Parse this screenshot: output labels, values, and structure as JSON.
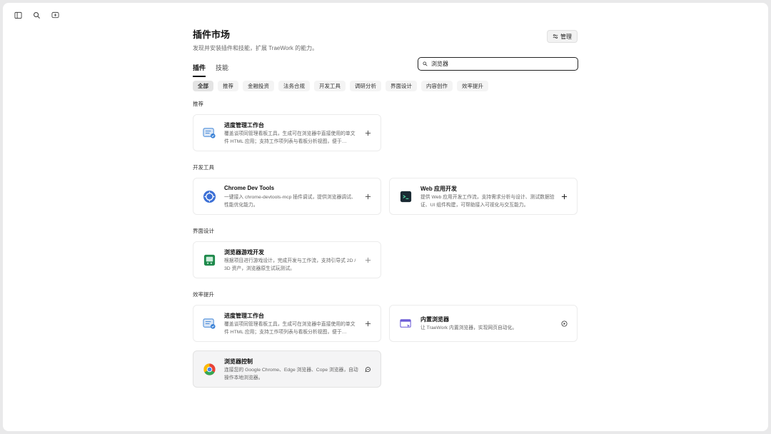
{
  "page": {
    "title": "插件市场",
    "subtitle": "发现并安装插件和技能，扩展 TraeWork 的能力。",
    "manage_label": "管理"
  },
  "tabs": [
    {
      "label": "插件",
      "active": true
    },
    {
      "label": "技能",
      "active": false
    }
  ],
  "search": {
    "value": "浏览器",
    "placeholder": "搜索"
  },
  "categories": [
    {
      "label": "全部",
      "active": true
    },
    {
      "label": "推荐"
    },
    {
      "label": "金融投资"
    },
    {
      "label": "法务合规"
    },
    {
      "label": "开发工具"
    },
    {
      "label": "调研分析"
    },
    {
      "label": "界面设计"
    },
    {
      "label": "内容创作"
    },
    {
      "label": "效率提升"
    }
  ],
  "sections": [
    {
      "label": "推荐",
      "cards": [
        {
          "title": "进度管理工作台",
          "desc": "覆盖谈项同管理看板工具，生成可在浏览器中直接使用的单文件 HTML 应用；支持工作项列表与看板分析视图，便于…",
          "icon": "progress-board-icon",
          "action": "plus"
        }
      ]
    },
    {
      "label": "开发工具",
      "cards": [
        {
          "title": "Chrome Dev Tools",
          "desc": "一键接入 chrome-devtools-mcp 插件调试，提供浏览器调试、性能优化能力。",
          "icon": "chrome-devtools-icon",
          "action": "plus"
        },
        {
          "title": "Web 应用开发",
          "desc": "提供 Web 应用开发工作流，支持需求分析与设计、测试数据验证、UI 组件构建，可帮助接入可视化与交互能力。",
          "icon": "terminal-icon",
          "action": "plus"
        }
      ]
    },
    {
      "label": "界面设计",
      "cards": [
        {
          "title": "浏览器游戏开发",
          "desc": "根据项目进行游戏设计，完成开发与工作流，支持引导式 2D / 3D 资产，浏览器原生试玩测试。",
          "icon": "game-icon",
          "action": "plus"
        }
      ]
    },
    {
      "label": "效率提升",
      "cards": [
        {
          "title": "进度管理工作台",
          "desc": "覆盖谈项同管理看板工具，生成可在浏览器中直接使用的单文件 HTML 应用；支持工作项列表与看板分析视图，便于…",
          "icon": "progress-board-icon",
          "action": "plus"
        },
        {
          "title": "内置浏览器",
          "desc": "让 TraeWork 内置浏览器，实现网页自动化。",
          "icon": "browser-window-icon",
          "action": "installed"
        },
        {
          "title": "浏览器控制",
          "desc": "连接您的 Google Chrome、Edge 浏览器、Cope 浏览器，自动操作本地浏览器。",
          "icon": "chrome-icon",
          "action": "chat"
        }
      ]
    }
  ],
  "colors": {
    "accent": "#1f1f1f",
    "blue": "#3b82d6",
    "green": "#1f8a4c"
  }
}
